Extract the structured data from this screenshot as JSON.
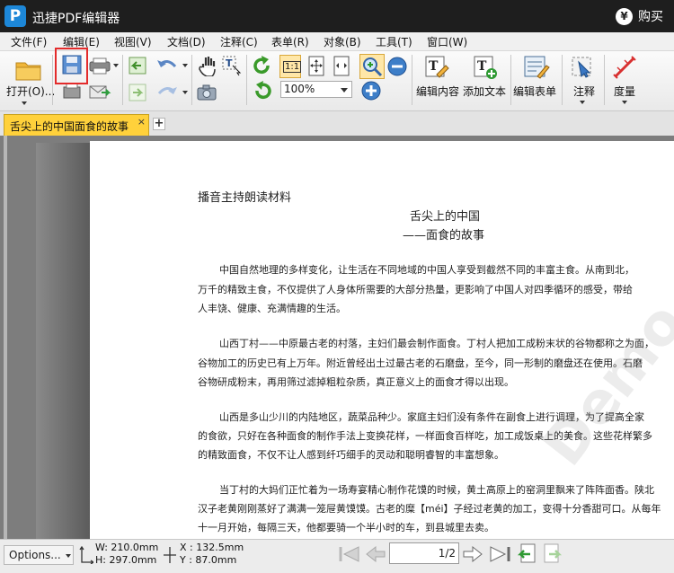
{
  "app": {
    "title": "迅捷PDF编辑器",
    "logo_letter": "P",
    "buy_label": "购买",
    "buy_icon": "yen-icon"
  },
  "menu": [
    "文件(F)",
    "编辑(E)",
    "视图(V)",
    "文档(D)",
    "注释(C)",
    "表单(R)",
    "对象(B)",
    "工具(T)",
    "窗口(W)"
  ],
  "toolbar": {
    "open_label": "打开(O)...",
    "zoom_value": "100%",
    "edit_content": "编辑内容",
    "add_text": "添加文本",
    "edit_form": "编辑表单",
    "annotate": "注释",
    "measure": "度量",
    "actual_size": "1:1"
  },
  "tabs": {
    "doc_tab": "舌尖上的中国面食的故事",
    "close": "×",
    "add": "+"
  },
  "document": {
    "header": "播音主持朗读材料",
    "title1": "舌尖上的中国",
    "title2": "——面食的故事",
    "lines": [
      "中国自然地理的多样变化，让生活在不同地域的中国人享受到截然不同的丰富主食。从南到北，",
      "万千的精致主食，不仅提供了人身体所需要的大部分热量，更影响了中国人对四季循环的感受，带给",
      "人丰饶、健康、充满情趣的生活。",
      "山西丁村——中原最古老的村落，主妇们最会制作面食。丁村人把加工成粉末状的谷物都称之为面，",
      "谷物加工的历史已有上万年。附近曾经出土过最古老的石磨盘，至今，同一形制的磨盘还在使用。石磨",
      "谷物研成粉末，再用筛过滤掉粗粒杂质，真正意义上的面食才得以出现。",
      "山西是多山少川的内陆地区，蔬菜品种少。家庭主妇们没有条件在副食上进行调理，为了提高全家",
      "的食欲，只好在各种面食的制作手法上变换花样，一样面食百样吃，加工成饭桌上的美食。这些花样繁多",
      "的精致面食，不仅不让人感到纤巧细手的灵动和聪明睿智的丰富想象。",
      "当丁村的大妈们正忙着为一场寿宴精心制作花馍的时候，黄土高原上的窑洞里飘来了阵阵面香。陕北",
      "汉子老黄刚刚蒸好了满满一笼屉黄馍馍。古老的糜【méi】子经过老黄的加工，变得十分香甜可口。从每年",
      "十一月开始，每隔三天，他都要骑一个半小时的车，到县城里去卖。"
    ],
    "watermark": "Demo vers"
  },
  "status": {
    "options": "Options...",
    "width": "W: 210.0mm",
    "height": "H: 297.0mm",
    "x": "X : 132.5mm",
    "y": "Y :   87.0mm",
    "page": "1/2"
  },
  "colors": {
    "titlebar": "#1e1e1e",
    "tab_active": "#ffd13b",
    "highlight": "#e32b2b",
    "logo": "#1d87d8"
  }
}
